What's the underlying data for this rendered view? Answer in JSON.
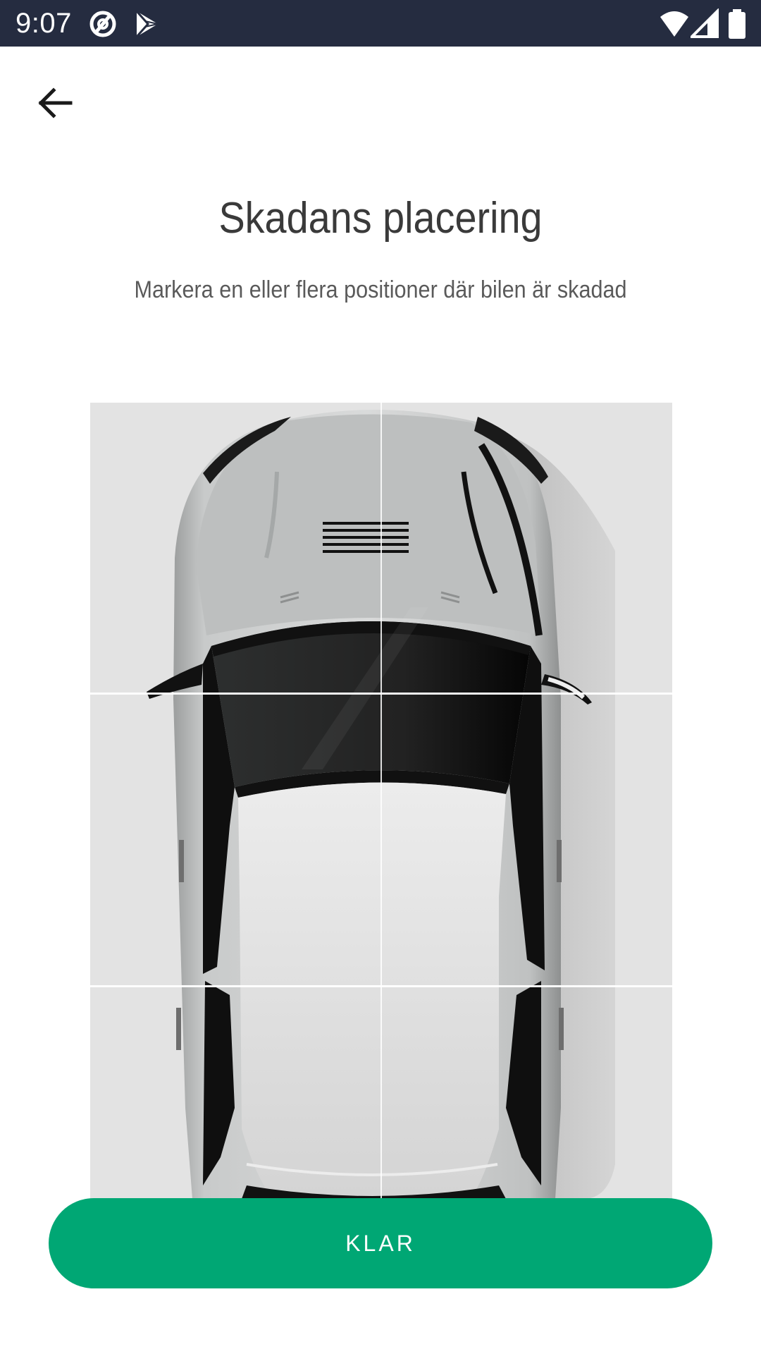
{
  "status_bar": {
    "time": "9:07",
    "icons": [
      "at-sign-icon",
      "play-store-icon",
      "wifi-icon",
      "signal-icon",
      "battery-icon"
    ],
    "background_color": "#252c40"
  },
  "toolbar": {
    "back_icon": "arrow-left-icon"
  },
  "header": {
    "title": "Skadans placering",
    "subtitle": "Markera en eller flera positioner där bilen är skadad"
  },
  "car_diagram": {
    "view": "car-top-view",
    "grid_columns": 2,
    "zones": [
      "front-left",
      "front-right",
      "middle-left",
      "middle-right",
      "rear-left",
      "rear-right"
    ]
  },
  "actions": {
    "done_label": "KLAR",
    "done_color": "#00a774"
  }
}
